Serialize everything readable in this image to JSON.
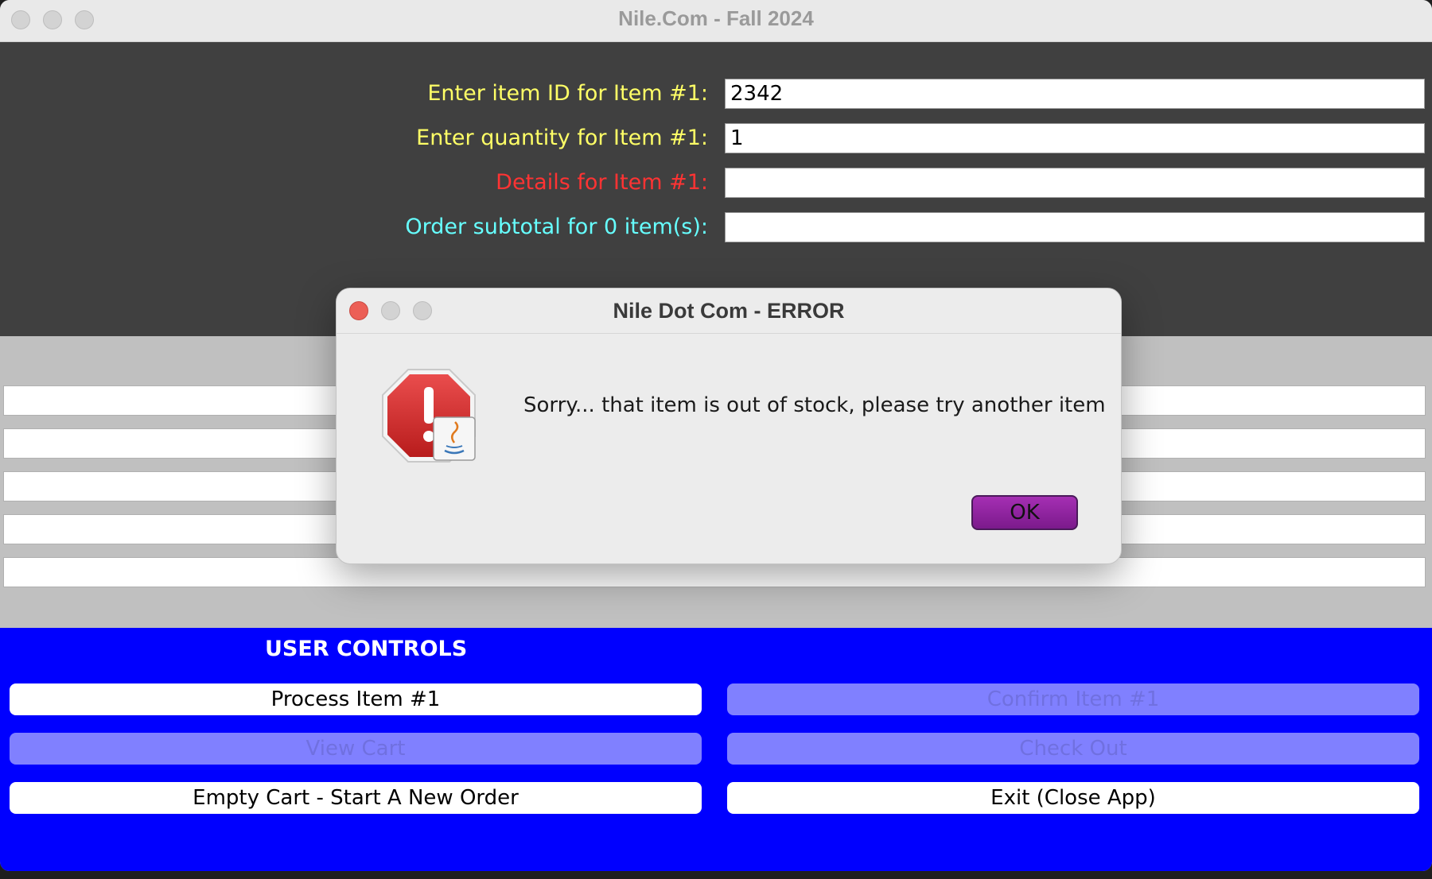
{
  "window": {
    "title": "Nile.Com - Fall 2024"
  },
  "form": {
    "item_id_label": "Enter item ID for Item #1:",
    "item_id_value": "2342",
    "quantity_label": "Enter quantity for Item #1:",
    "quantity_value": "1",
    "details_label": "Details for Item #1:",
    "details_value": "",
    "subtotal_label": "Order subtotal for 0 item(s):",
    "subtotal_value": "",
    "colors": {
      "item_id_label": "#ffff66",
      "quantity_label": "#ffff66",
      "details_label": "#ff3333",
      "subtotal_label": "#66ffff"
    }
  },
  "cart": {
    "lines": [
      "",
      "",
      "",
      "",
      ""
    ]
  },
  "controls": {
    "title": "USER CONTROLS",
    "process_item": "Process Item #1",
    "confirm_item": "Confirm Item #1",
    "view_cart": "View Cart",
    "check_out": "Check Out",
    "empty_cart": "Empty Cart - Start A New Order",
    "exit": "Exit (Close App)",
    "background_color": "#0000ff"
  },
  "dialog": {
    "title": "Nile Dot Com - ERROR",
    "message": "Sorry... that item is out of stock, please try another item",
    "ok_label": "OK",
    "icon": "error-stop-icon"
  }
}
